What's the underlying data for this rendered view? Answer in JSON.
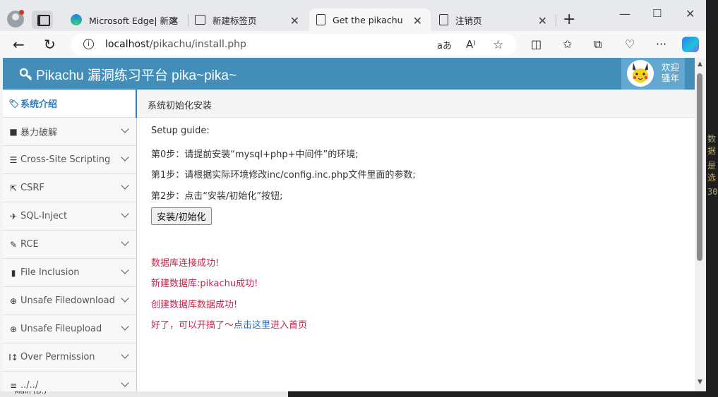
{
  "browser": {
    "tabs": [
      {
        "title": "Microsoft Edge| 新建",
        "icon": "edge-icon"
      },
      {
        "title": "新建标签页",
        "icon": "newtab-icon"
      },
      {
        "title": "Get the pikachu",
        "icon": "page-icon",
        "active": true
      },
      {
        "title": "注销页",
        "icon": "page-icon"
      }
    ],
    "url_host": "localhost",
    "url_path": "/pikachu/install.php"
  },
  "site": {
    "title": "Pikachu 漏洞练习平台 pika~pika~",
    "user_line1": "欢迎",
    "user_line2": "骚年"
  },
  "sidebar": {
    "items": [
      {
        "label": "系统介绍",
        "icon": "tag-icon",
        "active": true
      },
      {
        "label": "暴力破解",
        "icon": "lock-icon"
      },
      {
        "label": "Cross-Site Scripting",
        "icon": "list-icon"
      },
      {
        "label": "CSRF",
        "icon": "share-icon"
      },
      {
        "label": "SQL-Inject",
        "icon": "plane-icon"
      },
      {
        "label": "RCE",
        "icon": "pencil-icon"
      },
      {
        "label": "File Inclusion",
        "icon": "file-icon"
      },
      {
        "label": "Unsafe Filedownload",
        "icon": "download-icon"
      },
      {
        "label": "Unsafe Fileupload",
        "icon": "upload-icon"
      },
      {
        "label": "Over Permission",
        "icon": "text-height-icon"
      },
      {
        "label": "../../",
        "icon": "align-icon"
      }
    ]
  },
  "breadcrumb": "系统初始化安装",
  "guide": {
    "heading": "Setup guide:",
    "step0": "第0步：请提前安装“mysql+php+中间件”的环境;",
    "step1": "第1步：请根据实际环境修改inc/config.inc.php文件里面的参数;",
    "step2": "第2步：点击“安装/初始化”按钮;",
    "button": "安装/初始化"
  },
  "messages": {
    "db_connect": "数据库连接成功!",
    "db_create": "新建数据库:pikachu成功!",
    "data_create": "创建数据库数据成功!",
    "done_prefix": "好了，可以开搞了～",
    "done_link": "点击这里",
    "done_suffix": "进入首页"
  },
  "background": {
    "status_text": "Main (D:)"
  }
}
